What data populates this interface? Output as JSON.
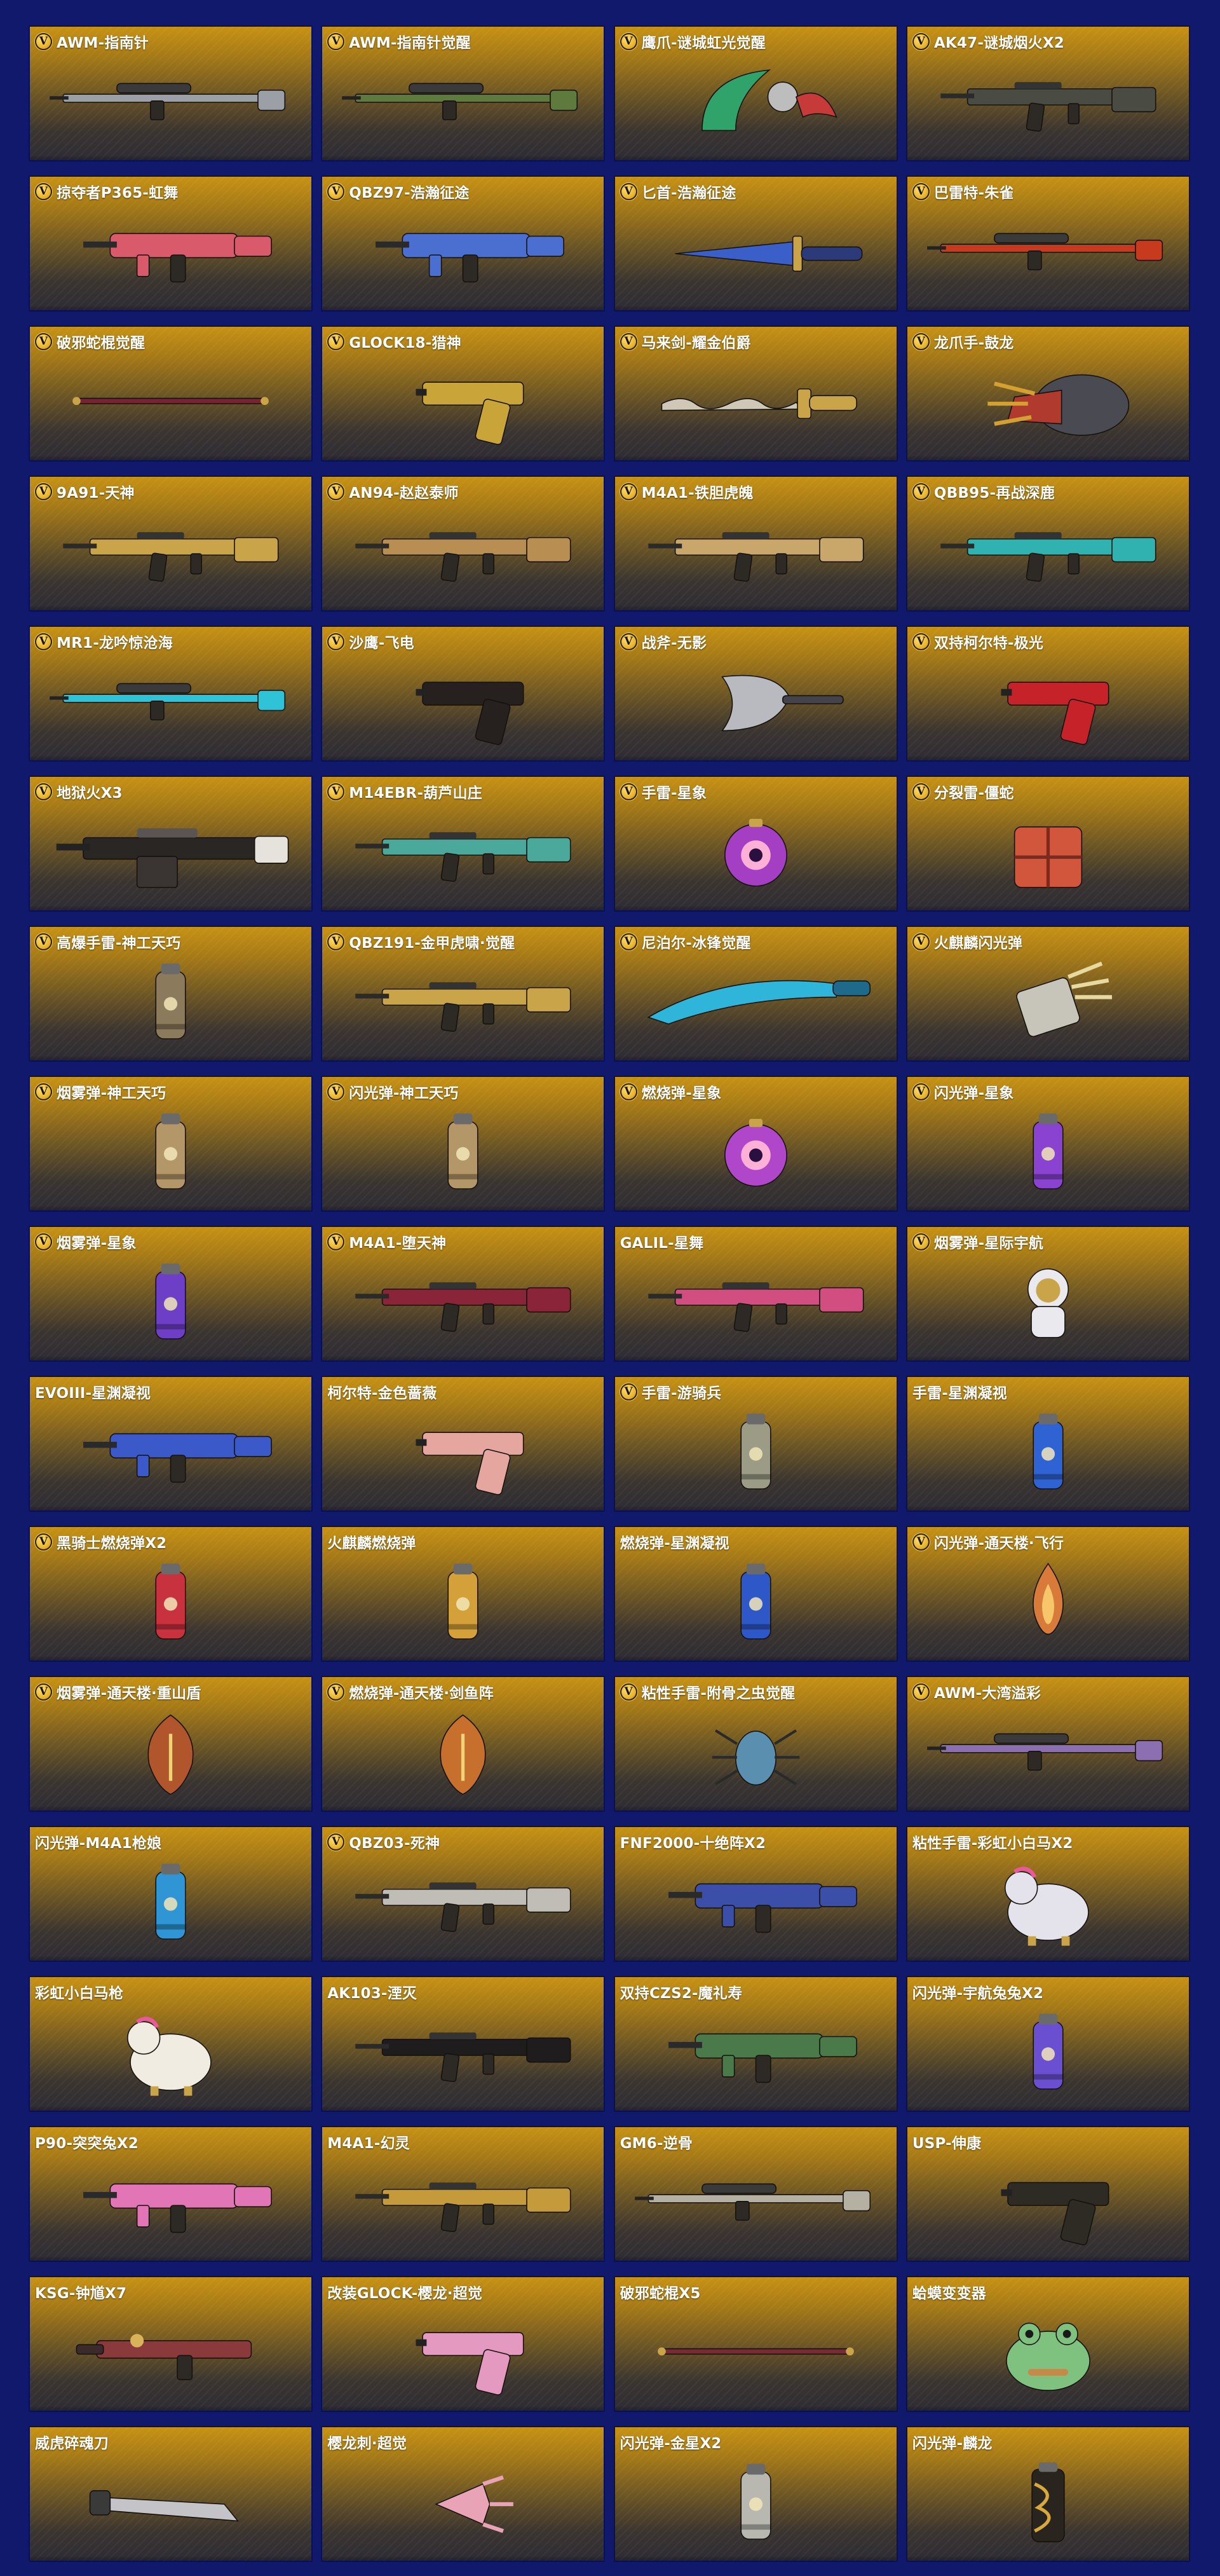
{
  "colors": {
    "page_background": "#10196b",
    "card_gold": "#c79214",
    "card_dark": "#2e2c34",
    "badge_gold": "#e9b52a",
    "title_text": "#ffffff"
  },
  "badge_label": "V",
  "items": [
    {
      "name": "AWM-指南针",
      "badge": true,
      "icon": "sniper-rifle-icon",
      "color": "#9aa0a6"
    },
    {
      "name": "AWM-指南针觉醒",
      "badge": true,
      "icon": "sniper-rifle-icon",
      "color": "#5f7a3d"
    },
    {
      "name": "鹰爪-谜城虹光觉醒",
      "badge": true,
      "icon": "claw-knife-icon",
      "color": "#2fa36a"
    },
    {
      "name": "AK47-谜城烟火X2",
      "badge": true,
      "icon": "assault-rifle-icon",
      "color": "#4a4c44"
    },
    {
      "name": "掠夺者P365-虹舞",
      "badge": true,
      "icon": "smg-icon",
      "color": "#d95b6b"
    },
    {
      "name": "QBZ97-浩瀚征途",
      "badge": true,
      "icon": "smg-icon",
      "color": "#4a6fd0"
    },
    {
      "name": "匕首-浩瀚征途",
      "badge": true,
      "icon": "dagger-icon",
      "color": "#3b5fc9"
    },
    {
      "name": "巴雷特-朱雀",
      "badge": true,
      "icon": "sniper-rifle-icon",
      "color": "#c83a1e"
    },
    {
      "name": "破邪蛇棍觉醒",
      "badge": true,
      "icon": "staff-icon",
      "color": "#7a2330"
    },
    {
      "name": "GLOCK18-猎神",
      "badge": true,
      "icon": "pistol-icon",
      "color": "#c9a438"
    },
    {
      "name": "马来剑-耀金伯爵",
      "badge": true,
      "icon": "kris-sword-icon",
      "color": "#cfc8b6"
    },
    {
      "name": "龙爪手-鼓龙",
      "badge": true,
      "icon": "gauntlet-icon",
      "color": "#b03a2e"
    },
    {
      "name": "9A91-天神",
      "badge": true,
      "icon": "assault-rifle-icon",
      "color": "#c9a448"
    },
    {
      "name": "AN94-赵赵泰师",
      "badge": true,
      "icon": "assault-rifle-icon",
      "color": "#b88e52"
    },
    {
      "name": "M4A1-铁胆虎魄",
      "badge": true,
      "icon": "assault-rifle-icon",
      "color": "#c9a76b"
    },
    {
      "name": "QBB95-再战深鹿",
      "badge": true,
      "icon": "assault-rifle-icon",
      "color": "#2fb2b0"
    },
    {
      "name": "MR1-龙吟惊沧海",
      "badge": true,
      "icon": "sniper-rifle-icon",
      "color": "#2ec3d6"
    },
    {
      "name": "沙鹰-飞电",
      "badge": true,
      "icon": "pistol-icon",
      "color": "#26201e"
    },
    {
      "name": "战斧-无影",
      "badge": true,
      "icon": "axe-icon",
      "color": "#b9b9c0"
    },
    {
      "name": "双持柯尔特-极光",
      "badge": true,
      "icon": "pistol-icon",
      "color": "#c6222a"
    },
    {
      "name": "地狱火X3",
      "badge": true,
      "icon": "machine-gun-icon",
      "color": "#2a2624"
    },
    {
      "name": "M14EBR-葫芦山庄",
      "badge": true,
      "icon": "assault-rifle-icon",
      "color": "#4aa99a"
    },
    {
      "name": "手雷-星象",
      "badge": true,
      "icon": "grenade-orb-icon",
      "color": "#a43fc3"
    },
    {
      "name": "分裂雷-僵蛇",
      "badge": true,
      "icon": "crate-grenade-icon",
      "color": "#d2563c"
    },
    {
      "name": "高爆手雷-神工天巧",
      "badge": true,
      "icon": "canister-grenade-icon",
      "color": "#8c7a5c"
    },
    {
      "name": "QBZ191-金甲虎啸·觉醒",
      "badge": true,
      "icon": "assault-rifle-icon",
      "color": "#c9a448"
    },
    {
      "name": "尼泊尔-冰锋觉醒",
      "badge": true,
      "icon": "machete-icon",
      "color": "#2fb5d9"
    },
    {
      "name": "火麒麟闪光弹",
      "badge": true,
      "icon": "flash-device-icon",
      "color": "#c7c4b9"
    },
    {
      "name": "烟雾弹-神工天巧",
      "badge": true,
      "icon": "canister-grenade-icon",
      "color": "#b49768"
    },
    {
      "name": "闪光弹-神工天巧",
      "badge": true,
      "icon": "canister-grenade-icon",
      "color": "#b49768"
    },
    {
      "name": "燃烧弹-星象",
      "badge": true,
      "icon": "grenade-orb-icon",
      "color": "#b046c9"
    },
    {
      "name": "闪光弹-星象",
      "badge": true,
      "icon": "canister-grenade-icon",
      "color": "#8a43d1"
    },
    {
      "name": "烟雾弹-星象",
      "badge": true,
      "icon": "canister-grenade-icon",
      "color": "#6c3fc6"
    },
    {
      "name": "M4A1-堕天神",
      "badge": true,
      "icon": "assault-rifle-icon",
      "color": "#8a2438"
    },
    {
      "name": "GALIL-星舞",
      "badge": false,
      "icon": "assault-rifle-icon",
      "color": "#d24e80"
    },
    {
      "name": "烟雾弹-星际宇航",
      "badge": true,
      "icon": "astronaut-icon",
      "color": "#e9e9ee"
    },
    {
      "name": "EVOIII-星渊凝视",
      "badge": false,
      "icon": "smg-icon",
      "color": "#3b59c9"
    },
    {
      "name": "柯尔特-金色蔷薇",
      "badge": false,
      "icon": "pistol-icon",
      "color": "#e6a6a0"
    },
    {
      "name": "手雷-游骑兵",
      "badge": true,
      "icon": "canister-grenade-icon",
      "color": "#9c9c86"
    },
    {
      "name": "手雷-星渊凝视",
      "badge": false,
      "icon": "canister-grenade-icon",
      "color": "#2f63d4"
    },
    {
      "name": "黑骑士燃烧弹X2",
      "badge": true,
      "icon": "canister-grenade-icon",
      "color": "#c8313e"
    },
    {
      "name": "火麒麟燃烧弹",
      "badge": false,
      "icon": "canister-grenade-icon",
      "color": "#d4a03a"
    },
    {
      "name": "燃烧弹-星渊凝视",
      "badge": false,
      "icon": "canister-grenade-icon",
      "color": "#2e58c8"
    },
    {
      "name": "闪光弹-通天楼·飞行",
      "badge": true,
      "icon": "flame-icon",
      "color": "#d87a3a"
    },
    {
      "name": "烟雾弹-通天楼·重山盾",
      "badge": true,
      "icon": "shield-grenade-icon",
      "color": "#b0552c"
    },
    {
      "name": "燃烧弹-通天楼·剑鱼阵",
      "badge": true,
      "icon": "shield-grenade-icon",
      "color": "#c7702e"
    },
    {
      "name": "粘性手雷-附骨之虫觉醒",
      "badge": true,
      "icon": "bug-grenade-icon",
      "color": "#5a8fb0"
    },
    {
      "name": "AWM-大湾溢彩",
      "badge": true,
      "icon": "sniper-rifle-icon",
      "color": "#8c6fb0"
    },
    {
      "name": "闪光弹-M4A1枪娘",
      "badge": false,
      "icon": "canister-grenade-icon",
      "color": "#2f95d4"
    },
    {
      "name": "QBZ03-死神",
      "badge": true,
      "icon": "assault-rifle-icon",
      "color": "#bfbdb6"
    },
    {
      "name": "FNF2000-十绝阵X2",
      "badge": false,
      "icon": "smg-icon",
      "color": "#3b4fa8"
    },
    {
      "name": "粘性手雷-彩虹小白马X2",
      "badge": false,
      "icon": "creature-icon",
      "color": "#e4e2ea"
    },
    {
      "name": "彩虹小白马枪",
      "badge": false,
      "icon": "creature-icon",
      "color": "#f0ece2"
    },
    {
      "name": "AK103-湮灭",
      "badge": false,
      "icon": "assault-rifle-icon",
      "color": "#1f1c1e"
    },
    {
      "name": "双持CZS2-魔礼寿",
      "badge": false,
      "icon": "smg-icon",
      "color": "#4a7a4a"
    },
    {
      "name": "闪光弹-宇航兔兔X2",
      "badge": false,
      "icon": "canister-grenade-icon",
      "color": "#6a4fd0"
    },
    {
      "name": "P90-突突兔X2",
      "badge": false,
      "icon": "smg-icon",
      "color": "#e275b5"
    },
    {
      "name": "M4A1-幻灵",
      "badge": false,
      "icon": "assault-rifle-icon",
      "color": "#c59a3a"
    },
    {
      "name": "GM6-逆骨",
      "badge": false,
      "icon": "sniper-rifle-icon",
      "color": "#b4b0a2"
    },
    {
      "name": "USP-伸康",
      "badge": false,
      "icon": "pistol-icon",
      "color": "#2e2a24"
    },
    {
      "name": "KSG-钟馗X7",
      "badge": false,
      "icon": "shotgun-icon",
      "color": "#8a3a3a"
    },
    {
      "name": "改装GLOCK-樱龙·超觉",
      "badge": false,
      "icon": "pistol-icon",
      "color": "#e49ac0"
    },
    {
      "name": "破邪蛇棍X5",
      "badge": false,
      "icon": "staff-icon",
      "color": "#7a2a33"
    },
    {
      "name": "蛤蟆变变器",
      "badge": false,
      "icon": "frog-icon",
      "color": "#7fc27f"
    },
    {
      "name": "威虎碎魂刀",
      "badge": false,
      "icon": "blade-icon",
      "color": "#c4c4c8"
    },
    {
      "name": "樱龙刺·超觉",
      "badge": false,
      "icon": "fan-blade-icon",
      "color": "#e8a3b6"
    },
    {
      "name": "闪光弹-金星X2",
      "badge": false,
      "icon": "canister-grenade-icon",
      "color": "#b8b8b0"
    },
    {
      "name": "闪光弹-麟龙",
      "badge": false,
      "icon": "dragon-canister-icon",
      "color": "#2a241e"
    }
  ]
}
